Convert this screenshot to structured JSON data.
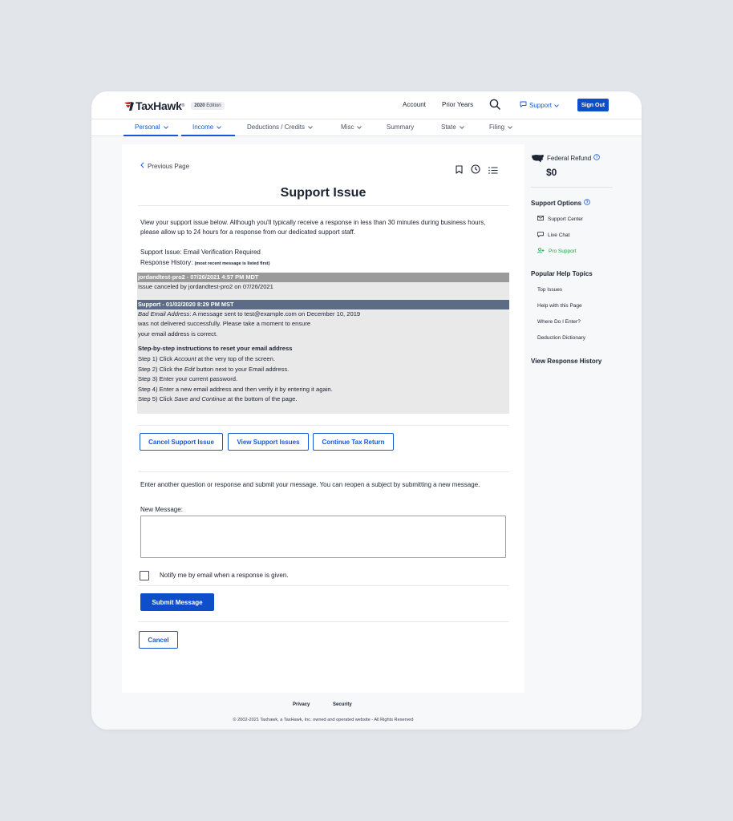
{
  "header": {
    "logo_text": "TaxHawk",
    "logo_tm": "®",
    "edition_year": "2020",
    "edition_word": "Edition",
    "links": {
      "account": "Account",
      "prior_years": "Prior Years",
      "support": "Support"
    },
    "sign_out": "Sign Out"
  },
  "nav": {
    "items": [
      "Personal",
      "Income",
      "Deductions / Credits",
      "Misc",
      "Summary",
      "State",
      "Filing"
    ]
  },
  "main": {
    "previous_page": "Previous Page",
    "title": "Support Issue",
    "intro": "View your support issue below. Although you'll typically receive a response in less than 30 minutes during business hours, please allow up to 24 hours for a response from our dedicated support staff.",
    "support_issue": "Support Issue: Email Verification Required",
    "response_history_label": "Response History:",
    "response_history_note": "(most recent message is listed first)",
    "messages": {
      "m1_header": "jordandtest-pro2 - 07/26/2021 4:57 PM MDT",
      "m1_body": "Issue canceled by jordandtest-pro2 on 07/26/2021",
      "m2_header": "Support - 01/02/2020 8:29 PM MST",
      "m2_line1_em": "Bad Email Address",
      "m2_line1_rest": ": A message sent to test@example.com on December 10, 2019",
      "m2_line2": "was not delivered successfully. Please take a moment to ensure",
      "m2_line3": "your email address is correct.",
      "m2_steps_title": "Step-by-step instructions to reset your email address",
      "step1_a": "Step 1) Click ",
      "step1_em": "Account",
      "step1_b": " at the very top of the screen.",
      "step2_a": "Step 2) Click the ",
      "step2_em": "Edit",
      "step2_b": " button next to your Email address.",
      "step3": "Step 3) Enter your current password.",
      "step4": "Step 4) Enter a new email address and then verify it by entering it again.",
      "step5_a": "Step 5) Click ",
      "step5_em": "Save and Continue",
      "step5_b": " at the bottom of the page."
    },
    "buttons": {
      "cancel_issue": "Cancel Support Issue",
      "view_issues": "View Support Issues",
      "continue_return": "Continue Tax Return",
      "submit": "Submit Message",
      "cancel": "Cancel"
    },
    "again_text": "Enter another question or response and submit your message. You can reopen a subject by submitting a new message.",
    "new_message_label": "New Message:",
    "new_message_value": "",
    "notify_label": "Notify me by email when a response is given."
  },
  "sidebar": {
    "refund_label": "Federal Refund",
    "refund_value": "$0",
    "support_options_title": "Support Options",
    "support_options": [
      "Support Center",
      "Live Chat",
      "Pro Support"
    ],
    "help_topics_title": "Popular Help Topics",
    "help_topics": [
      "Top Issues",
      "Help with this Page",
      "Where Do I Enter?",
      "Deduction Dictionary"
    ],
    "view_history": "View Response History"
  },
  "footer": {
    "privacy": "Privacy",
    "security": "Security",
    "copyright": "© 2002-2021 Taxhawk, a TaxHawk, Inc. owned and operated website - All Rights Reserved"
  },
  "colors": {
    "accent": "#1558d6",
    "primary_button": "#0f4ec9",
    "pro_support": "#1aa34a",
    "message_header_user": "#9a9a9a",
    "message_header_support": "#5d6c86"
  }
}
